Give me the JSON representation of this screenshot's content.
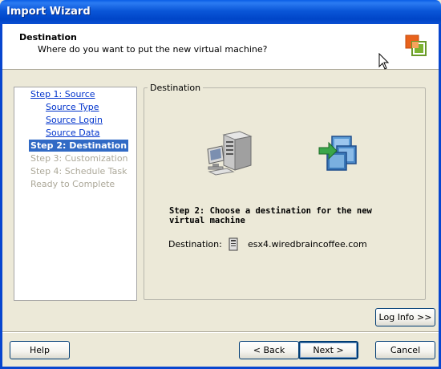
{
  "window": {
    "title": "Import Wizard"
  },
  "header": {
    "title": "Destination",
    "subtitle": "Where do you want to put the new virtual machine?"
  },
  "steps": [
    {
      "label": "Step 1: Source",
      "state": "link"
    },
    {
      "label": "Source Type",
      "state": "link"
    },
    {
      "label": "Source Login",
      "state": "link"
    },
    {
      "label": "Source Data",
      "state": "link"
    },
    {
      "label": "Step 2: Destination",
      "state": "active"
    },
    {
      "label": "Step 3: Customization",
      "state": "disabled"
    },
    {
      "label": "Step 4: Schedule Task",
      "state": "disabled"
    },
    {
      "label": "Ready to Complete",
      "state": "disabled"
    }
  ],
  "main": {
    "group_label": "Destination",
    "instruction": "Step 2: Choose a destination for the new virtual machine",
    "destination_label": "Destination:",
    "destination_value": "esx4.wiredbraincoffee.com",
    "icons": [
      "server-icon",
      "virtual-machine-icon",
      "host-icon"
    ]
  },
  "buttons": {
    "log_info": "Log Info >>",
    "help": "Help",
    "back": "< Back",
    "next": "Next >",
    "cancel": "Cancel"
  },
  "colors": {
    "titlebar": "#0a56d8",
    "selection": "#316ac5",
    "link": "#0033cc",
    "disabled": "#aca899",
    "dialog_bg": "#ece9d8"
  }
}
